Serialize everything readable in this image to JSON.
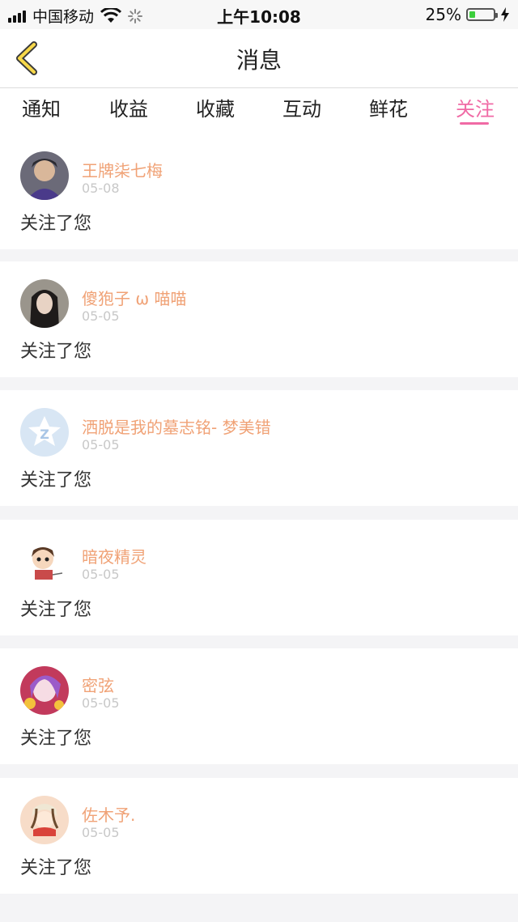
{
  "status_bar": {
    "carrier": "中国移动",
    "time": "上午10:08",
    "battery_percent": "25%",
    "battery_level": 0.25,
    "icons": [
      "signal-icon",
      "wifi-icon",
      "loading-icon",
      "battery-icon",
      "charging-bolt-icon"
    ]
  },
  "navbar": {
    "back_icon": "chevron-left-icon",
    "title": "消息"
  },
  "tabs": [
    {
      "label": "通知"
    },
    {
      "label": "收益"
    },
    {
      "label": "收藏"
    },
    {
      "label": "互动"
    },
    {
      "label": "鲜花"
    },
    {
      "label": "关注",
      "active": true
    }
  ],
  "colors": {
    "accent": "#f06aa5",
    "username": "#f0a276",
    "date": "#c8c8c8",
    "background": "#f4f4f6"
  },
  "notifications": [
    {
      "name": "王牌柒七梅",
      "date": "05-08",
      "text": "关注了您"
    },
    {
      "name": "傻狍子 ω 喵喵",
      "date": "05-05",
      "text": "关注了您"
    },
    {
      "name": "洒脱是我的墓志铭- 梦美错",
      "date": "05-05",
      "text": "关注了您"
    },
    {
      "name": "暗夜精灵",
      "date": "05-05",
      "text": "关注了您"
    },
    {
      "name": "密弦",
      "date": "05-05",
      "text": "关注了您"
    },
    {
      "name": "佐木予.",
      "date": "05-05",
      "text": "关注了您"
    }
  ]
}
